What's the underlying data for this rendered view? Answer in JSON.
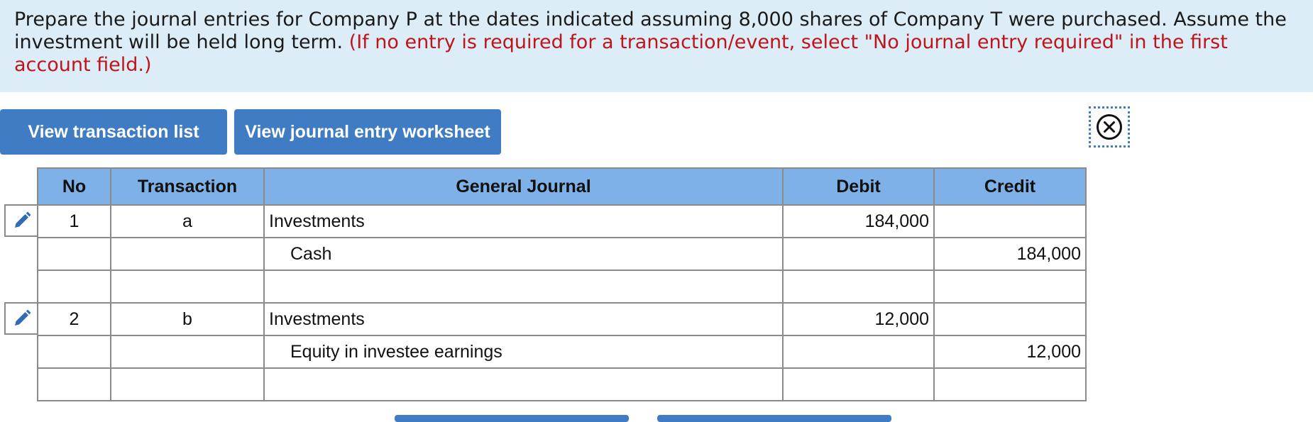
{
  "instructions": {
    "main": "Prepare the journal entries for Company P at the dates indicated assuming 8,000 shares of Company T were purchased. Assume the investment will be held long term.",
    "note": "(If no entry is required for a transaction/event, select \"No journal entry required\" in the first account field.)"
  },
  "buttons": {
    "view_transaction_list": "View transaction list",
    "view_journal_entry_worksheet": "View journal entry worksheet"
  },
  "icons": {
    "close": "close-circle-icon",
    "edit": "pencil-icon"
  },
  "colors": {
    "accent": "#3f7cc3",
    "header_bg": "#7eb1e7",
    "instructions_bg": "#ddedf8",
    "note_text": "#c0141b"
  },
  "table": {
    "headers": {
      "no": "No",
      "transaction": "Transaction",
      "general_journal": "General Journal",
      "debit": "Debit",
      "credit": "Credit"
    },
    "rows": [
      {
        "no": "1",
        "transaction": "a",
        "account": "Investments",
        "debit": "184,000",
        "credit": ""
      },
      {
        "no": "",
        "transaction": "",
        "account": "Cash",
        "debit": "",
        "credit": "184,000"
      },
      {
        "no": "",
        "transaction": "",
        "account": "",
        "debit": "",
        "credit": ""
      },
      {
        "no": "2",
        "transaction": "b",
        "account": "Investments",
        "debit": "12,000",
        "credit": ""
      },
      {
        "no": "",
        "transaction": "",
        "account": "Equity in investee earnings",
        "debit": "",
        "credit": "12,000"
      },
      {
        "no": "",
        "transaction": "",
        "account": "",
        "debit": "",
        "credit": ""
      }
    ]
  }
}
